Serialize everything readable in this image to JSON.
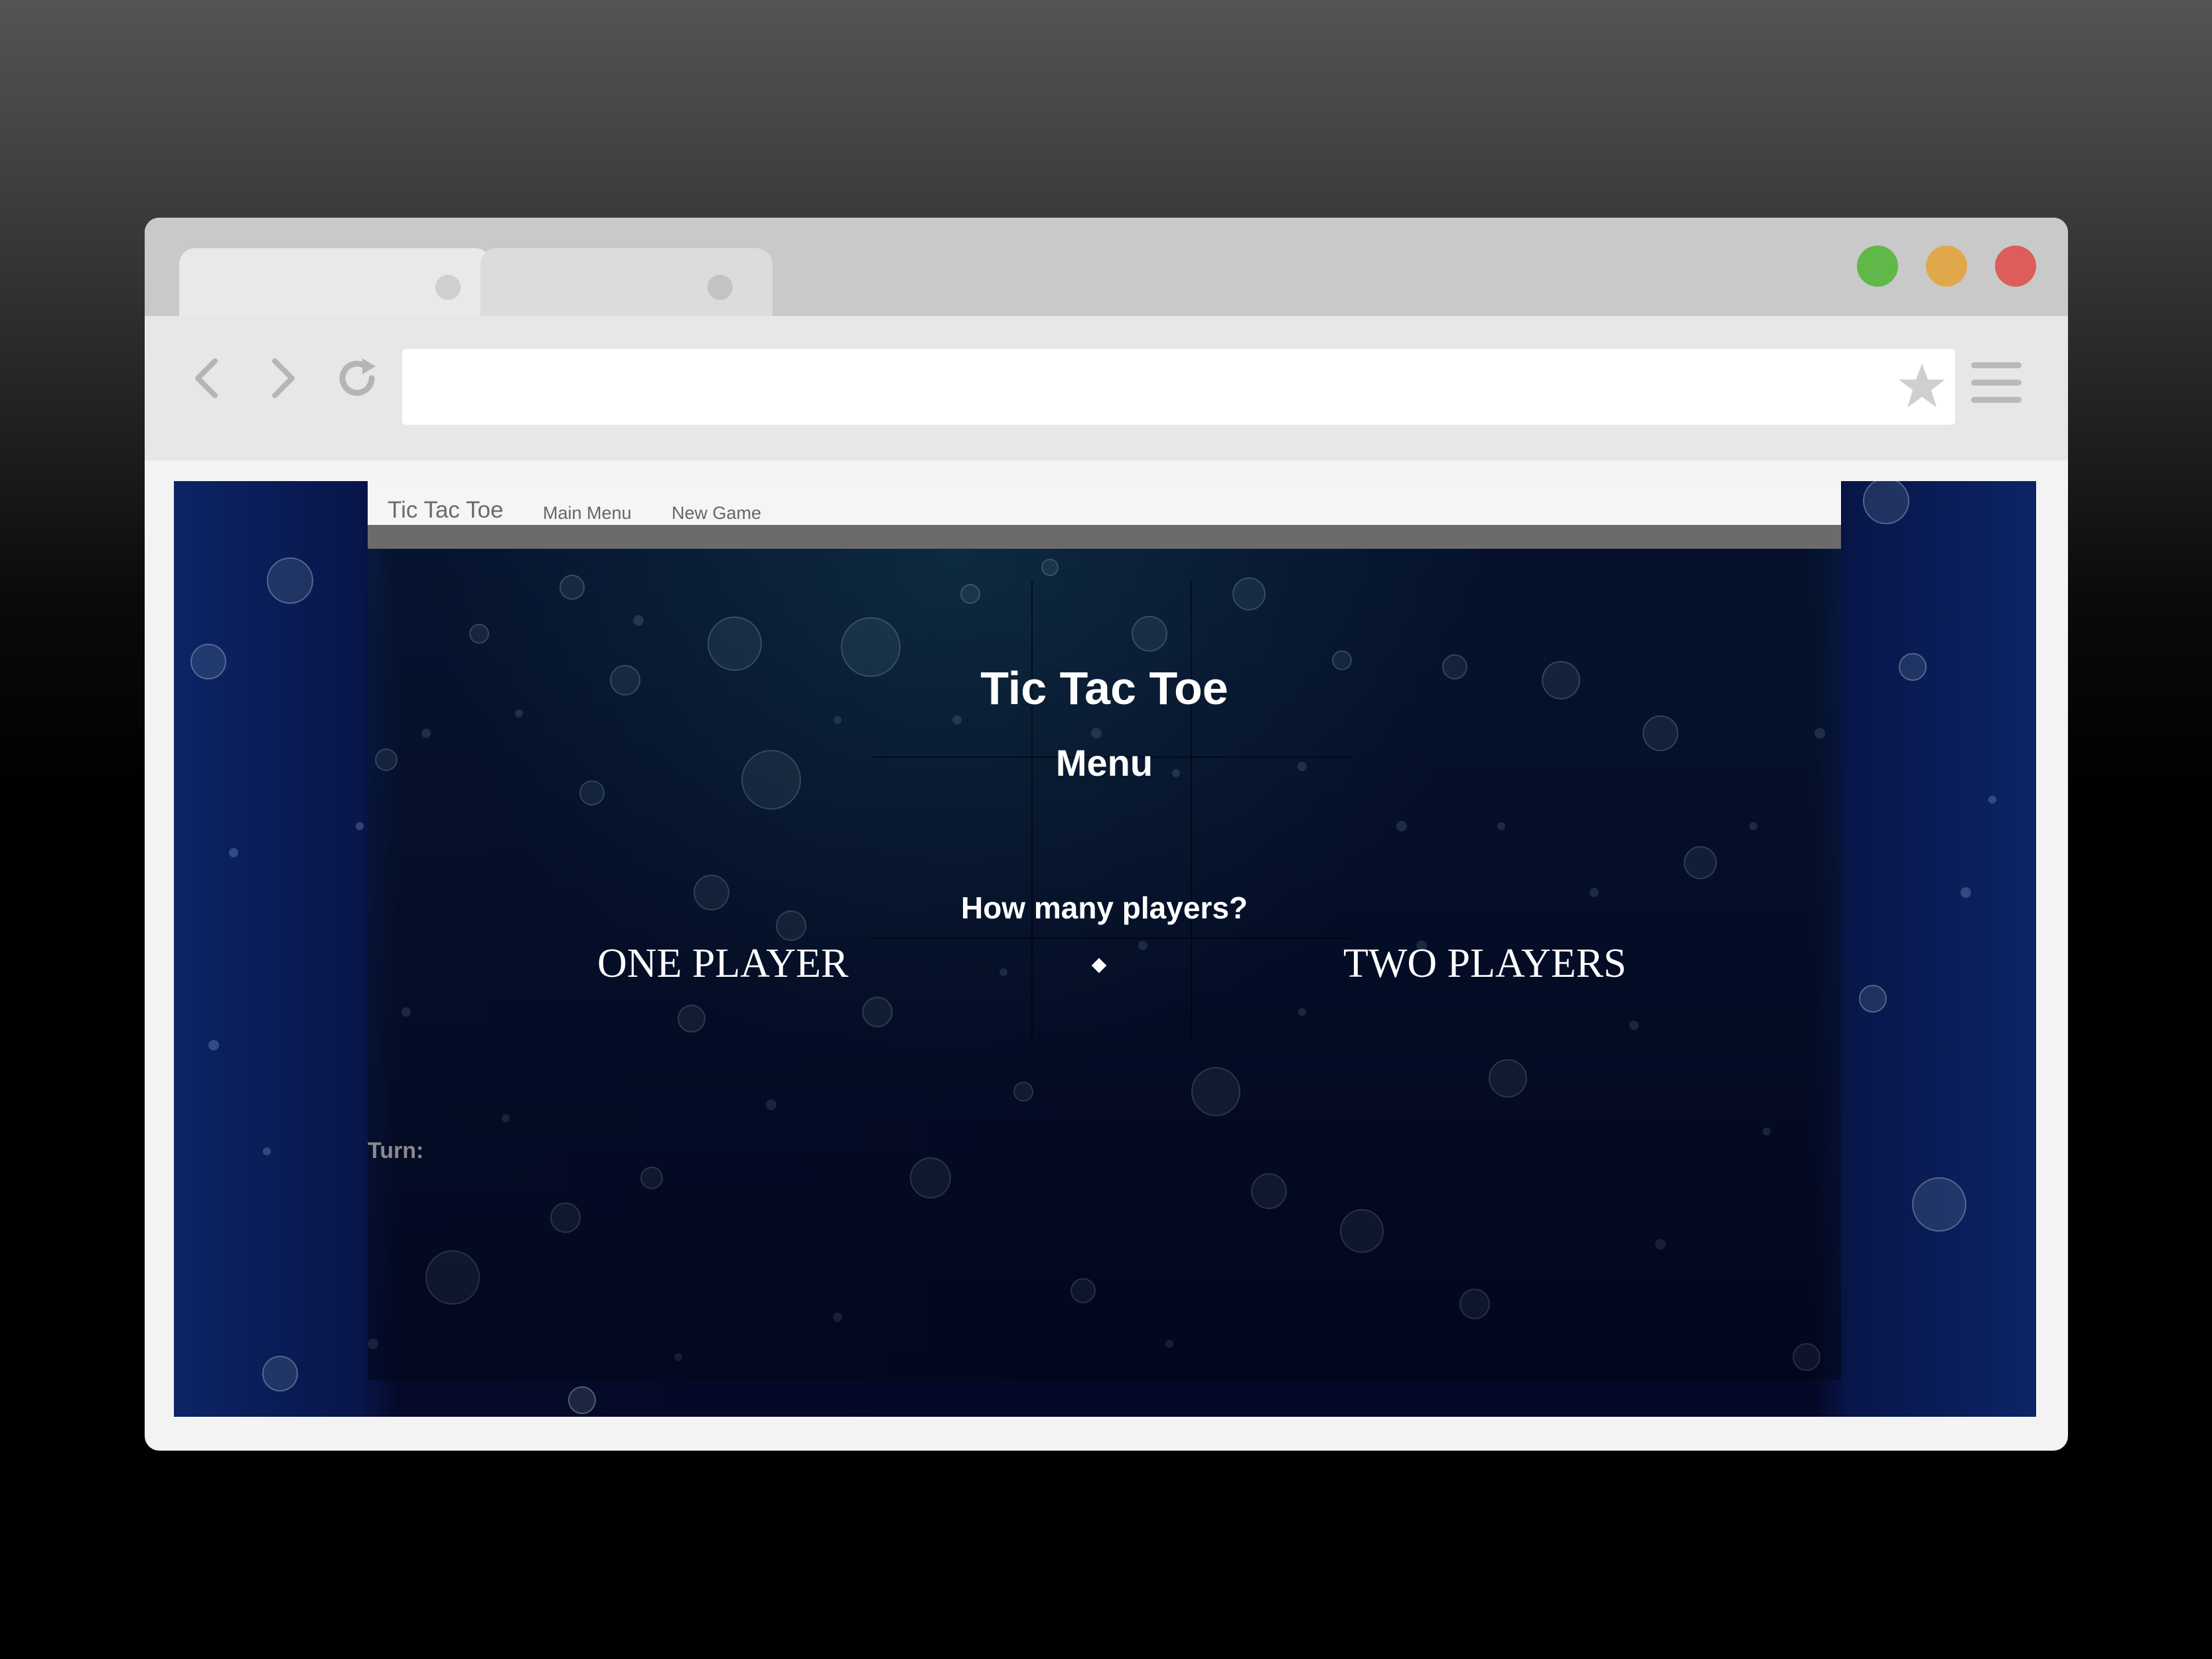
{
  "browser": {
    "tabs": [
      {
        "state": "active"
      },
      {
        "state": "inactive"
      }
    ],
    "window_controls": [
      "green",
      "yellow",
      "red"
    ],
    "colors": {
      "green": "#5fb847",
      "yellow": "#e0a84a",
      "red": "#dd5d5b"
    },
    "address_value": "",
    "icons": [
      "back-arrow-icon",
      "forward-arrow-icon",
      "reload-icon",
      "star-icon",
      "hamburger-menu-icon"
    ]
  },
  "page": {
    "nav": {
      "brand": "Tic Tac Toe",
      "main_menu": "Main Menu",
      "new_game": "New Game"
    },
    "title": "Tic Tac Toe",
    "subtitle": "Menu",
    "question": "How many players?",
    "one_player": "ONE PLAYER",
    "two_players": "TWO PLAYERS",
    "turn_label": "Turn:"
  }
}
